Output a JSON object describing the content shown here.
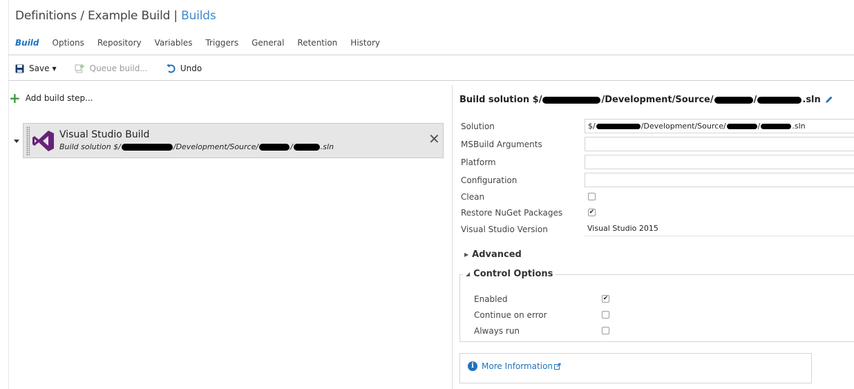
{
  "header": {
    "breadcrumb_definitions": "Definitions",
    "separator": "/",
    "definition_name": "Example Build",
    "pipe": "|",
    "builds_link": "Builds"
  },
  "tabs": [
    "Build",
    "Options",
    "Repository",
    "Variables",
    "Triggers",
    "General",
    "Retention",
    "History"
  ],
  "toolbar": {
    "save_label": "Save",
    "queue_label": "Queue build...",
    "undo_label": "Undo"
  },
  "steps": {
    "add_label": "Add build step...",
    "items": [
      {
        "name": "Visual Studio Build",
        "sub_prefix": "Build solution $/",
        "sub_mid1": "/Development/Source/",
        "sub_mid2": "/",
        "sub_suffix": ".sln"
      }
    ]
  },
  "details": {
    "title_prefix": "Build solution $/",
    "title_mid": "/Development/Source/",
    "title_sep": "/",
    "title_suffix": ".sln",
    "fields": {
      "solution_label": "Solution",
      "solution_prefix": "$/",
      "solution_mid": "/Development/Source/",
      "solution_sep": "/",
      "solution_suffix": ".sln",
      "msbuild_label": "MSBuild Arguments",
      "msbuild_value": "",
      "platform_label": "Platform",
      "platform_value": "",
      "configuration_label": "Configuration",
      "configuration_value": "",
      "clean_label": "Clean",
      "clean_checked": false,
      "restore_label": "Restore NuGet Packages",
      "restore_checked": true,
      "vsversion_label": "Visual Studio Version",
      "vsversion_value": "Visual Studio 2015"
    },
    "advanced_label": "Advanced",
    "control_options": {
      "label": "Control Options",
      "enabled_label": "Enabled",
      "enabled_checked": true,
      "continue_label": "Continue on error",
      "continue_checked": false,
      "always_label": "Always run",
      "always_checked": false
    },
    "more_info_label": "More Information"
  },
  "colors": {
    "accent": "#1e73be",
    "link": "#3d8bd0",
    "vs_purple": "#68217a",
    "add_green": "#3b9a3b"
  }
}
